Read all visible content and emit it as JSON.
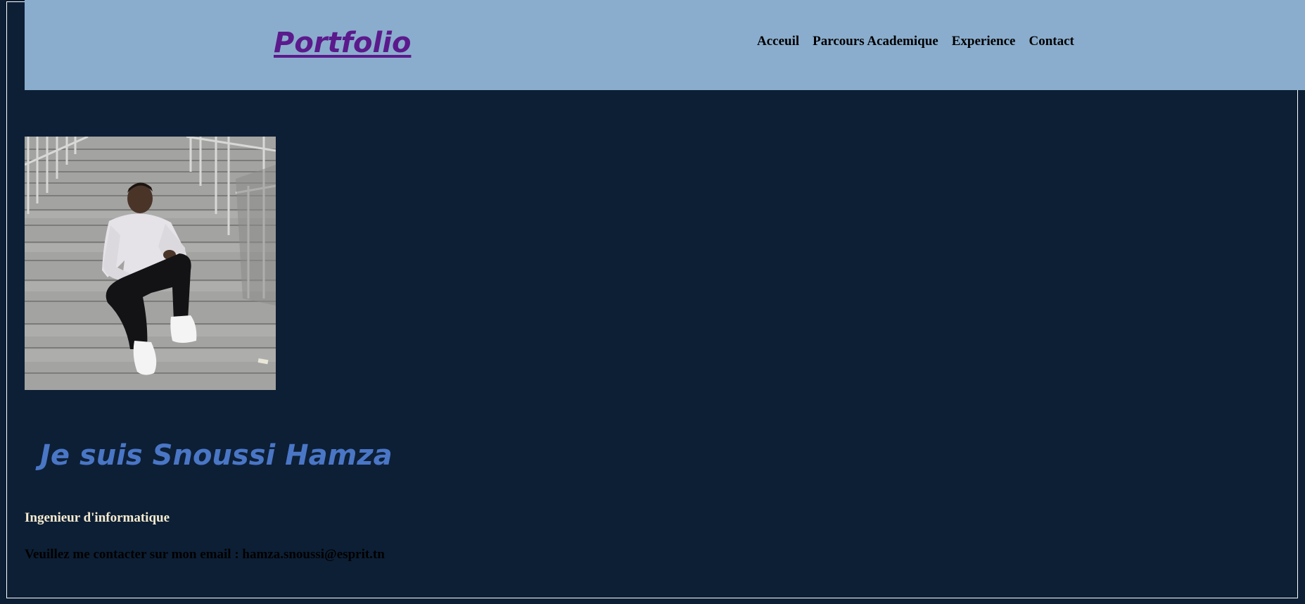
{
  "header": {
    "brand": "Portfolio",
    "nav": [
      "Acceuil",
      "Parcours Academique",
      "Experience",
      "Contact"
    ]
  },
  "hero": {
    "title": "Je suis Snoussi Hamza",
    "role": "Ingenieur d'informatique",
    "contact_text": "Veuillez me contacter sur mon email : hamza.snoussi@esprit.tn"
  },
  "colors": {
    "background": "#0d1f35",
    "header_bg": "#8aadcd",
    "brand": "#5b1a8c",
    "hero_title": "#4a76c6",
    "role_text": "#f5ebd0"
  }
}
